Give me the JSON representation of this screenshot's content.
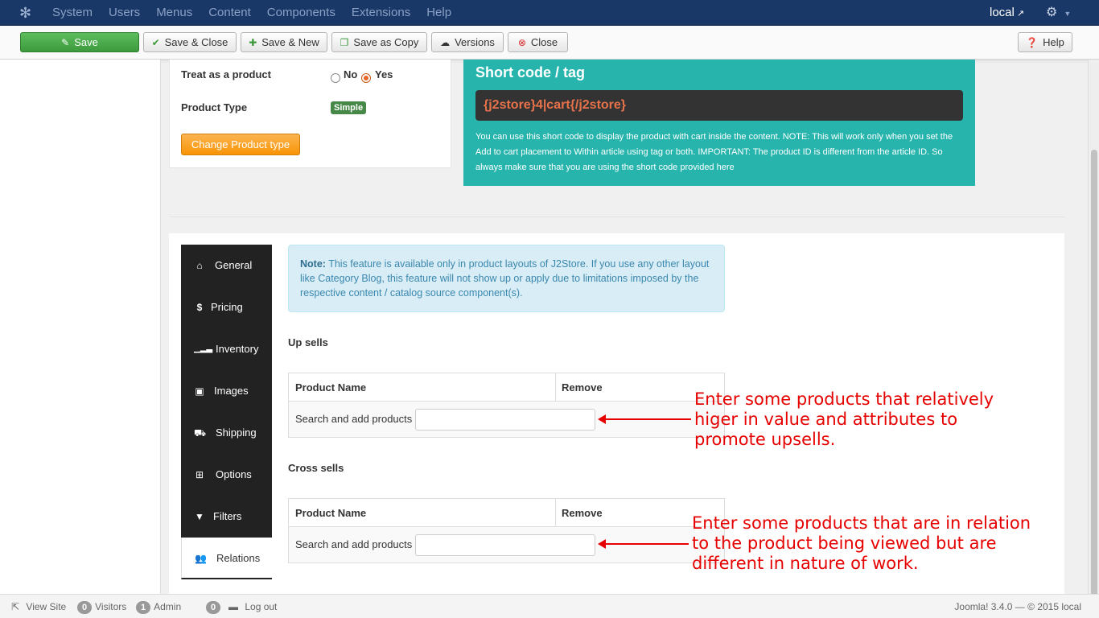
{
  "navbar": {
    "menu": [
      "System",
      "Users",
      "Menus",
      "Content",
      "Components",
      "Extensions",
      "Help"
    ],
    "user": "local"
  },
  "toolbar": {
    "save": "Save",
    "save_close": "Save & Close",
    "save_new": "Save & New",
    "save_copy": "Save as Copy",
    "versions": "Versions",
    "close": "Close",
    "help": "Help"
  },
  "product": {
    "treat_label": "Treat as a product",
    "no_label": "No",
    "yes_label": "Yes",
    "selected": "Yes",
    "type_label": "Product Type",
    "type_badge": "Simple",
    "change_button": "Change Product type"
  },
  "shortcode": {
    "title": "Short code / tag",
    "code": "{j2store}4|cart{/j2store}",
    "description": "You can use this short code to display the product with cart inside the content. NOTE: This will work only when you set the Add to cart placement to Within article using tag or both. IMPORTANT: The product ID is different from the article ID. So always make sure that you are using the short code provided here"
  },
  "tabs": [
    {
      "label": "General",
      "icon": "home-icon"
    },
    {
      "label": "Pricing",
      "icon": "dollar-icon"
    },
    {
      "label": "Inventory",
      "icon": "signal-icon"
    },
    {
      "label": "Images",
      "icon": "image-icon"
    },
    {
      "label": "Shipping",
      "icon": "truck-icon"
    },
    {
      "label": "Options",
      "icon": "sitemap-icon"
    },
    {
      "label": "Filters",
      "icon": "filter-icon"
    },
    {
      "label": "Relations",
      "icon": "users-icon"
    }
  ],
  "active_tab": "Relations",
  "note": {
    "prefix": "Note:",
    "text": " This feature is available only in product layouts of J2Store. If you use any other layout like Category Blog, this feature will not show up or apply due to limitations imposed by the respective content / catalog source component(s)."
  },
  "upsells": {
    "heading": "Up sells",
    "col_name": "Product Name",
    "col_remove": "Remove",
    "search_label": "Search and add products",
    "search_value": ""
  },
  "crosssells": {
    "heading": "Cross sells",
    "col_name": "Product Name",
    "col_remove": "Remove",
    "search_label": "Search and add products",
    "search_value": ""
  },
  "annotations": {
    "upsell": [
      "Enter some products that relatively",
      "higer in value and attributes to",
      "promote upsells."
    ],
    "crosssell": [
      "Enter some products that are in relation",
      "to the product being viewed but are",
      "different in nature of work."
    ]
  },
  "statusbar": {
    "view_site": "View Site",
    "visitors_count": "0",
    "visitors": "Visitors",
    "admin_count": "1",
    "admin": "Admin",
    "messages_count": "0",
    "logout": "Log out",
    "footer": "Joomla! 3.4.0 — © 2015 local"
  }
}
